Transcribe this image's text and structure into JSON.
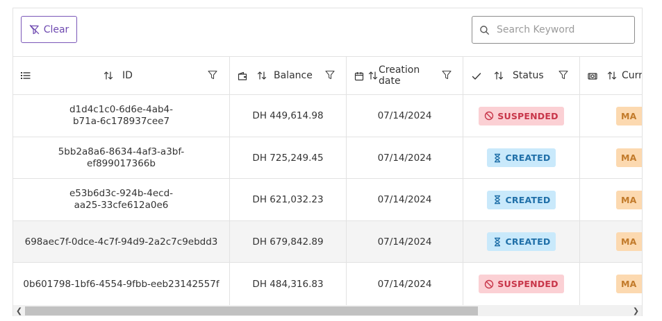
{
  "toolbar": {
    "clear_label": "Clear",
    "search_placeholder": "Search Keyword",
    "search_value": ""
  },
  "columns": [
    {
      "key": "id",
      "label": "ID",
      "icon": "list-icon"
    },
    {
      "key": "balance",
      "label": "Balance",
      "icon": "wallet-icon"
    },
    {
      "key": "creation_date",
      "label": "Creation date",
      "label_line1": "Creation",
      "label_line2": "date",
      "icon": "calendar-icon"
    },
    {
      "key": "status",
      "label": "Status",
      "icon": "check-icon"
    },
    {
      "key": "currency",
      "label": "Curr",
      "icon": "banknote-icon"
    }
  ],
  "rows": [
    {
      "id_line1": "d1d4c1c0-6d6e-4ab4-",
      "id_line2": "b71a-6c178937cee7",
      "balance": "DH 449,614.98",
      "date": "07/14/2024",
      "status": "SUSPENDED",
      "currency": "MA"
    },
    {
      "id_line1": "5bb2a8a6-8634-4af3-a3bf-",
      "id_line2": "ef899017366b",
      "balance": "DH 725,249.45",
      "date": "07/14/2024",
      "status": "CREATED",
      "currency": "MA"
    },
    {
      "id_line1": "e53b6d3c-924b-4ecd-",
      "id_line2": "aa25-33cfe612a0e6",
      "balance": "DH 621,032.23",
      "date": "07/14/2024",
      "status": "CREATED",
      "currency": "MA"
    },
    {
      "id_line1": "698aec7f-0dce-4c7f-94d9-2a2c7c9ebdd3",
      "id_line2": "",
      "balance": "DH 679,842.89",
      "date": "07/14/2024",
      "status": "CREATED",
      "currency": "MA"
    },
    {
      "id_line1": "0b601798-1bf6-4554-9fbb-eeb23142557f",
      "id_line2": "",
      "balance": "DH 484,316.83",
      "date": "07/14/2024",
      "status": "SUSPENDED",
      "currency": "MA"
    }
  ],
  "colors": {
    "accent": "#6e49b0",
    "suspended_bg": "#fbd0d4",
    "suspended_fg": "#c8364a",
    "created_bg": "#c9e9fb",
    "created_fg": "#1f6fa8",
    "currency_bg": "#fcd9b0",
    "currency_fg": "#c27a2a",
    "hover_row_bg": "#f4f4f4"
  }
}
